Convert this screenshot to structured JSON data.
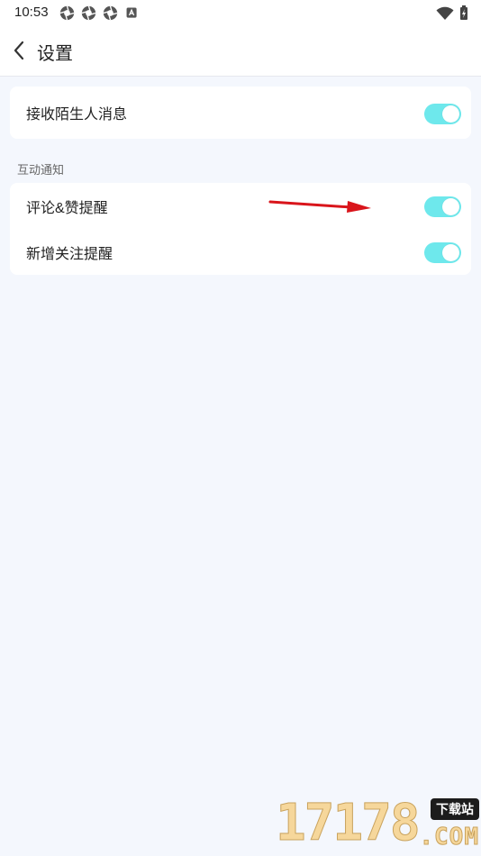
{
  "status_bar": {
    "time": "10:53",
    "notification_icons": [
      "aperture-icon",
      "aperture-icon",
      "aperture-icon",
      "a-box-icon"
    ],
    "right_icons": [
      "wifi-icon",
      "battery-charging-icon"
    ]
  },
  "header": {
    "title": "设置",
    "back_icon": "chevron-left-icon"
  },
  "settings": {
    "stranger_messages": {
      "label": "接收陌生人消息",
      "enabled": true
    },
    "section_title": "互动通知",
    "items": [
      {
        "label": "评论&赞提醒",
        "enabled": true
      },
      {
        "label": "新增关注提醒",
        "enabled": true
      }
    ]
  },
  "watermark": {
    "number": "17178",
    "badge": "下载站",
    "suffix": ".COM"
  },
  "colors": {
    "background": "#f4f7fd",
    "toggle_on": "#6ee8ec",
    "arrow": "#d9151b"
  }
}
